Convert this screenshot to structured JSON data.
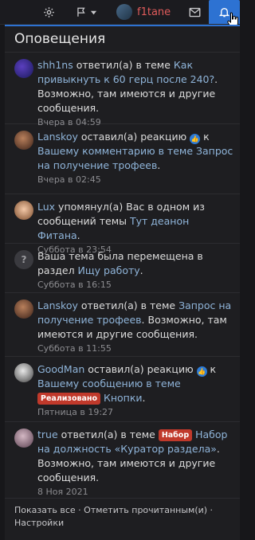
{
  "topbar": {
    "username": "f1tane"
  },
  "panel": {
    "title": "Оповещения"
  },
  "notifications": [
    {
      "parts": [
        "shh1ns",
        " ответил(а) в теме ",
        "Как привыкнуть к 60 герц после 240?",
        ". Возможно, там имеются и другие сообщения."
      ],
      "time": "Вчера в 04:59"
    },
    {
      "parts": [
        "Lanskoy",
        " оставил(а) реакцию ",
        "к ",
        "Вашему комментарию в теме ",
        "Запрос на получение трофеев",
        "."
      ],
      "time": "Вчера в 02:45"
    },
    {
      "parts": [
        "Lux",
        " упомянул(а) Вас в одном из сообщений темы ",
        "Тут деанон Фитана",
        "."
      ],
      "time": "Суббота в 23:54"
    },
    {
      "parts": [
        "Ваша тема была перемещена в раздел ",
        "Ищу работу",
        "."
      ],
      "time": "Суббота в 16:15"
    },
    {
      "parts": [
        "Lanskoy",
        " ответил(а) в теме ",
        "Запрос на получение трофеев",
        ". Возможно, там имеются и другие сообщения."
      ],
      "time": "Суббота в 11:55"
    },
    {
      "parts": [
        "GoodMan",
        " оставил(а) реакцию ",
        "к ",
        "Вашему сообщению в теме ",
        "Реализовано",
        "Кнопки",
        "."
      ],
      "time": "Пятница в 19:27"
    },
    {
      "parts": [
        "true",
        " ответил(а) в теме ",
        "Набор",
        "Набор на должность «Куратор раздела»",
        ". Возможно, там имеются и другие сообщения."
      ],
      "time": "8 Ноя 2021"
    }
  ],
  "footer": {
    "show_all": "Показать все",
    "sep1": " · ",
    "mark_read": "Отметить прочитанным(и)",
    "sep2": " · ",
    "settings": "Настройки"
  },
  "colors": {
    "accent": "#2d72d2",
    "link": "#8fb4d9",
    "username": "#e05b5b",
    "tag": "#c0392b"
  }
}
